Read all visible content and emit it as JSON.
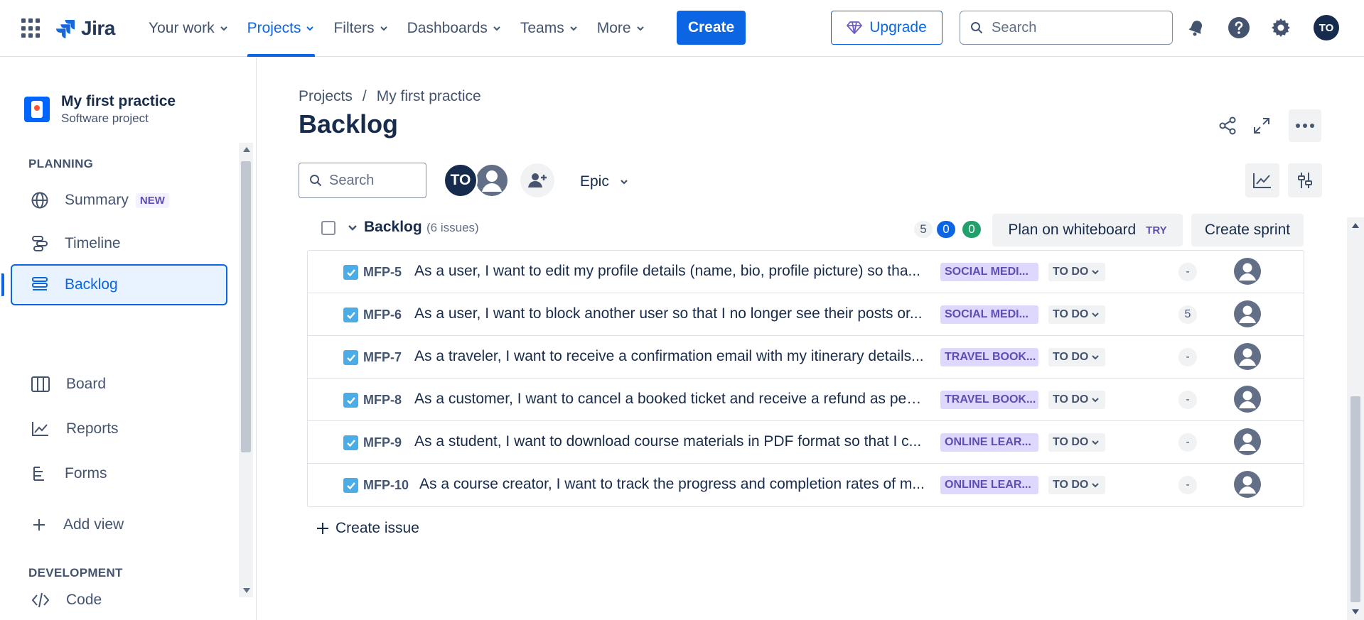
{
  "topnav": {
    "logo_text": "Jira",
    "items": [
      {
        "label": "Your work"
      },
      {
        "label": "Projects"
      },
      {
        "label": "Filters"
      },
      {
        "label": "Dashboards"
      },
      {
        "label": "Teams"
      },
      {
        "label": "More"
      }
    ],
    "active_item": "Projects",
    "create_label": "Create",
    "upgrade_label": "Upgrade",
    "search_placeholder": "Search",
    "avatar_initials": "TO",
    "accent_color": "#0c66e4"
  },
  "sidebar": {
    "project_name": "My first practice",
    "project_type": "Software project",
    "planning_label": "PLANNING",
    "development_label": "DEVELOPMENT",
    "items": [
      {
        "label": "Summary",
        "icon": "globe-icon",
        "badge": "NEW"
      },
      {
        "label": "Timeline",
        "icon": "timeline-icon"
      },
      {
        "label": "Backlog",
        "icon": "backlog-icon",
        "active": true
      },
      {
        "label": "Board",
        "icon": "board-icon"
      },
      {
        "label": "Reports",
        "icon": "reports-icon"
      },
      {
        "label": "Forms",
        "icon": "forms-icon"
      },
      {
        "label": "Add view",
        "icon": "plus-icon"
      },
      {
        "label": "Code",
        "icon": "code-icon"
      }
    ]
  },
  "main": {
    "breadcrumb": {
      "root": "Projects",
      "separator": "/",
      "current": "My first practice"
    },
    "title": "Backlog",
    "search_placeholder": "Search",
    "assignee_avatar_initials": "TO",
    "epic_filter_label": "Epic",
    "backlog": {
      "title": "Backlog",
      "issue_count_text": "(6 issues)",
      "counts": {
        "todo": "5",
        "in_progress": "0",
        "done": "0"
      },
      "plan_on_whiteboard_label": "Plan on whiteboard",
      "try_badge": "TRY",
      "create_sprint_label": "Create sprint",
      "create_issue_label": "Create issue"
    },
    "issues": [
      {
        "key": "MFP-5",
        "summary": "As a user, I want to edit my profile details (name, bio, profile picture) so tha...",
        "epic": "SOCIAL MEDI...",
        "status": "TO DO",
        "points": "-"
      },
      {
        "key": "MFP-6",
        "summary": "As a user, I want to block another user so that I no longer see their posts or...",
        "epic": "SOCIAL MEDI...",
        "status": "TO DO",
        "points": "5"
      },
      {
        "key": "MFP-7",
        "summary": "As a traveler, I want to receive a confirmation email with my itinerary details...",
        "epic": "TRAVEL BOOK...",
        "status": "TO DO",
        "points": "-"
      },
      {
        "key": "MFP-8",
        "summary": "As a customer, I want to cancel a booked ticket and receive a refund as per ...",
        "epic": "TRAVEL BOOK...",
        "status": "TO DO",
        "points": "-"
      },
      {
        "key": "MFP-9",
        "summary": "As a student, I want to download course materials in PDF format so that I c...",
        "epic": "ONLINE LEAR...",
        "status": "TO DO",
        "points": "-"
      },
      {
        "key": "MFP-10",
        "summary": "As a course creator, I want to track the progress and completion rates of m...",
        "epic": "ONLINE LEAR...",
        "status": "TO DO",
        "points": "-"
      }
    ]
  }
}
